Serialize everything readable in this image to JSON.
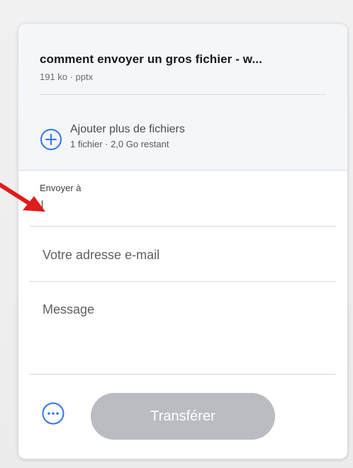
{
  "file": {
    "name": "comment envoyer un gros fichier - w...",
    "meta": "191 ko · pptx"
  },
  "add_more": {
    "title": "Ajouter plus de fichiers",
    "subtitle": "1 fichier · 2,0 Go restant"
  },
  "form": {
    "to_label": "Envoyer à",
    "to_value": "",
    "email_placeholder": "Votre adresse e-mail",
    "message_placeholder": "Message"
  },
  "footer": {
    "transfer_label": "Transférer"
  },
  "colors": {
    "accent": "#2f74ee",
    "button_disabled": "#b9bcc1",
    "annotation_arrow": "#e01b1b"
  },
  "icons": {
    "add": "plus-circle-icon",
    "options": "ellipsis-circle-icon",
    "annotation": "red-arrow-icon"
  }
}
